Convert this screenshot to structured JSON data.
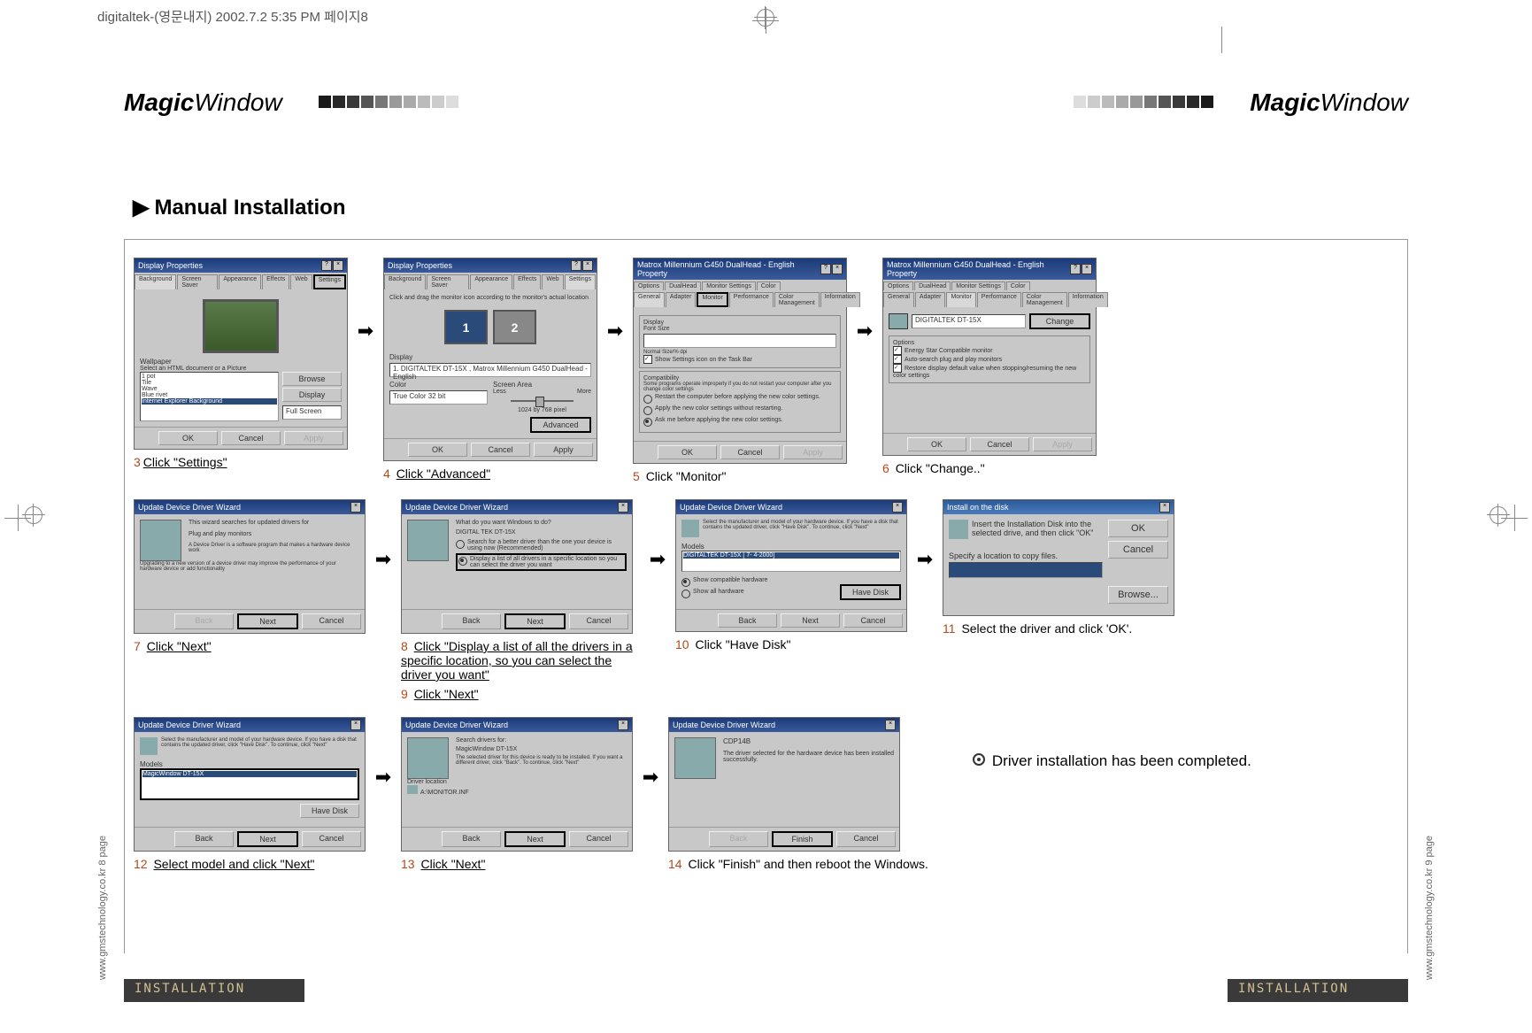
{
  "header_info": "digitaltek-(영문내지)  2002.7.2 5:35 PM  페이지8",
  "logo": {
    "bold": "Magic",
    "light": "Window"
  },
  "section_title": "Manual Installation",
  "footer": "INSTALLATION",
  "side_left": "www.gmstechnology.co.kr   8 page",
  "side_right": "www.gmstechnology.co.kr   9 page",
  "steps": {
    "s3": {
      "num": "3",
      "txt": "Click \"Settings\""
    },
    "s4": {
      "num": "4",
      "txt": "Click \"Advanced\""
    },
    "s5": {
      "num": "5",
      "txt": "Click \"Monitor\""
    },
    "s6": {
      "num": "6",
      "txt": "Click \"Change..\""
    },
    "s7": {
      "num": "7",
      "txt": "Click \"Next\""
    },
    "s8": {
      "num": "8",
      "txt": "Click \"Display a list of all the drivers in a specific location, so you can select the driver you want\""
    },
    "s9": {
      "num": "9",
      "txt": "Click \"Next\""
    },
    "s10": {
      "num": "10",
      "txt": "Click \"Have Disk\""
    },
    "s11": {
      "num": "11",
      "txt": "Select the driver and click 'OK'."
    },
    "s12": {
      "num": "12",
      "txt": "Select model and click \"Next\""
    },
    "s13": {
      "num": "13",
      "txt": "Click \"Next\""
    },
    "s14": {
      "num": "14",
      "txt": "Click \"Finish\" and then reboot the Windows."
    }
  },
  "completion": "Driver installation has been completed.",
  "win3": {
    "title": "Display Properties",
    "tabs": [
      "Background",
      "Screen Saver",
      "Appearance",
      "Effects",
      "Web",
      "Settings"
    ],
    "wallpaper_label": "Wallpaper",
    "wallpaper_hint": "Select an HTML document or a Picture",
    "items": [
      "1 pot",
      "Tile",
      "Wave",
      "Blue rivet",
      "Internet Explorer Background"
    ],
    "browse": "Browse",
    "display_btn": "Display",
    "display_val": "Full Screen",
    "ok": "OK",
    "cancel": "Cancel"
  },
  "win4": {
    "title": "Display Properties",
    "hint": "Click and drag the monitor icon according to the monitor's actual location",
    "display_label": "Display",
    "display_val": "1. DIGITALTEK DT-15X , Matrox Millennium G450 DualHead - English",
    "color_label": "Color",
    "color_val": "True Color 32 bit",
    "area_label": "Screen Area",
    "less": "Less",
    "more": "More",
    "res": "1024 by 768 pixel",
    "advanced": "Advanced",
    "ok": "OK",
    "cancel": "Cancel",
    "apply": "Apply"
  },
  "win5": {
    "title": "Matrox Millennium G450 DualHead - English Property",
    "tabs1": [
      "Options",
      "DualHead",
      "Monitor Settings",
      "Color"
    ],
    "tabs2": [
      "General",
      "Adapter",
      "Monitor",
      "Performance",
      "Color Management",
      "Information"
    ],
    "display_label": "Display",
    "font_label": "Font Size",
    "normal_hint": "Normal Size/% dpi",
    "show_settings": "Show Settings icon on the Task Bar",
    "compat_label": "Compatibility",
    "compat_hint": "Some programs operate improperly if you do not restart your computer after you change color settings",
    "r1": "Restart the computer before applying the new color settings.",
    "r2": "Apply the new color settings without restarting.",
    "r3": "Ask me before applying the new color settings.",
    "ok": "OK",
    "cancel": "Cancel"
  },
  "win6": {
    "title": "Matrox Millennium G450 DualHead - English Property",
    "monitor_val": "DIGITALTEK DT-15X",
    "change": "Change",
    "options_label": "Options",
    "o1": "Energy Star Compatible monitor",
    "o2": "Auto-search plug and play monitors",
    "o3": "Restore display default value when stopping/resuming the new color settings",
    "ok": "OK",
    "cancel": "Cancel"
  },
  "win7": {
    "title": "Update Device Driver Wizard",
    "l1": "This wizard searches for updated drivers for",
    "l2": "Plug and play monitors",
    "l3": "A Device Driver is a software program that makes a hardware device work",
    "l4": "Upgrading to a new version of a device driver may improve the performance of your hardware device or add functionality",
    "back": "Back",
    "next": "Next",
    "cancel": "Cancel"
  },
  "win8": {
    "title": "Update Device Driver Wizard",
    "q": "What do you want Windows to do?",
    "dev": "DIGITAL TEK DT-15X",
    "r1": "Search for a better driver than the one your device is using now (Recommended)",
    "r2": "Display a list of all drivers in a specific location so you can select the driver you want",
    "back": "Back",
    "next": "Next",
    "cancel": "Cancel"
  },
  "win10": {
    "title": "Update Device Driver Wizard",
    "hint": "Select the manufacturer and model of your hardware device. If you have a disk that contains the updated driver, click \"Have Disk\". To continue, click \"Next\"",
    "models_label": "Models",
    "model": "DIGITALTEK DT-15X  [ 7- 4-2000]",
    "show_comp": "Show compatible hardware",
    "show_all": "Show all hardware",
    "have_disk": "Have Disk",
    "back": "Back",
    "next": "Next",
    "cancel": "Cancel"
  },
  "win11": {
    "title": "Install on the disk",
    "msg": "Insert the Installation Disk into the selected drive, and then click \"OK\"",
    "spec": "Specify a location to copy files.",
    "ok": "OK",
    "cancel": "Cancel",
    "browse": "Browse..."
  },
  "win12": {
    "title": "Update Device Driver Wizard",
    "hint": "Select the manufacturer and model of your hardware device. If you have a disk that contains the updated driver, click \"Have Disk\". To continue, click \"Next\"",
    "models_label": "Models",
    "model": "MagicWindow DT-15X",
    "have_disk": "Have Disk",
    "back": "Back",
    "next": "Next",
    "cancel": "Cancel"
  },
  "win13": {
    "title": "Update Device Driver Wizard",
    "l1": "Search drivers for:",
    "dev": "MagicWindow DT-15X",
    "msg": "The selected driver for this device is ready to be installed. If you want a different driver, click \"Back\". To continue, click \"Next\"",
    "loc_label": "Driver location",
    "loc": "A:\\MONITOR.INF",
    "back": "Back",
    "next": "Next",
    "cancel": "Cancel"
  },
  "win14": {
    "title": "Update Device Driver Wizard",
    "dev": "CDP14B",
    "msg": "The driver selected for the hardware device has been installed successfully.",
    "back": "Back",
    "finish": "Finish",
    "cancel": "Cancel"
  }
}
